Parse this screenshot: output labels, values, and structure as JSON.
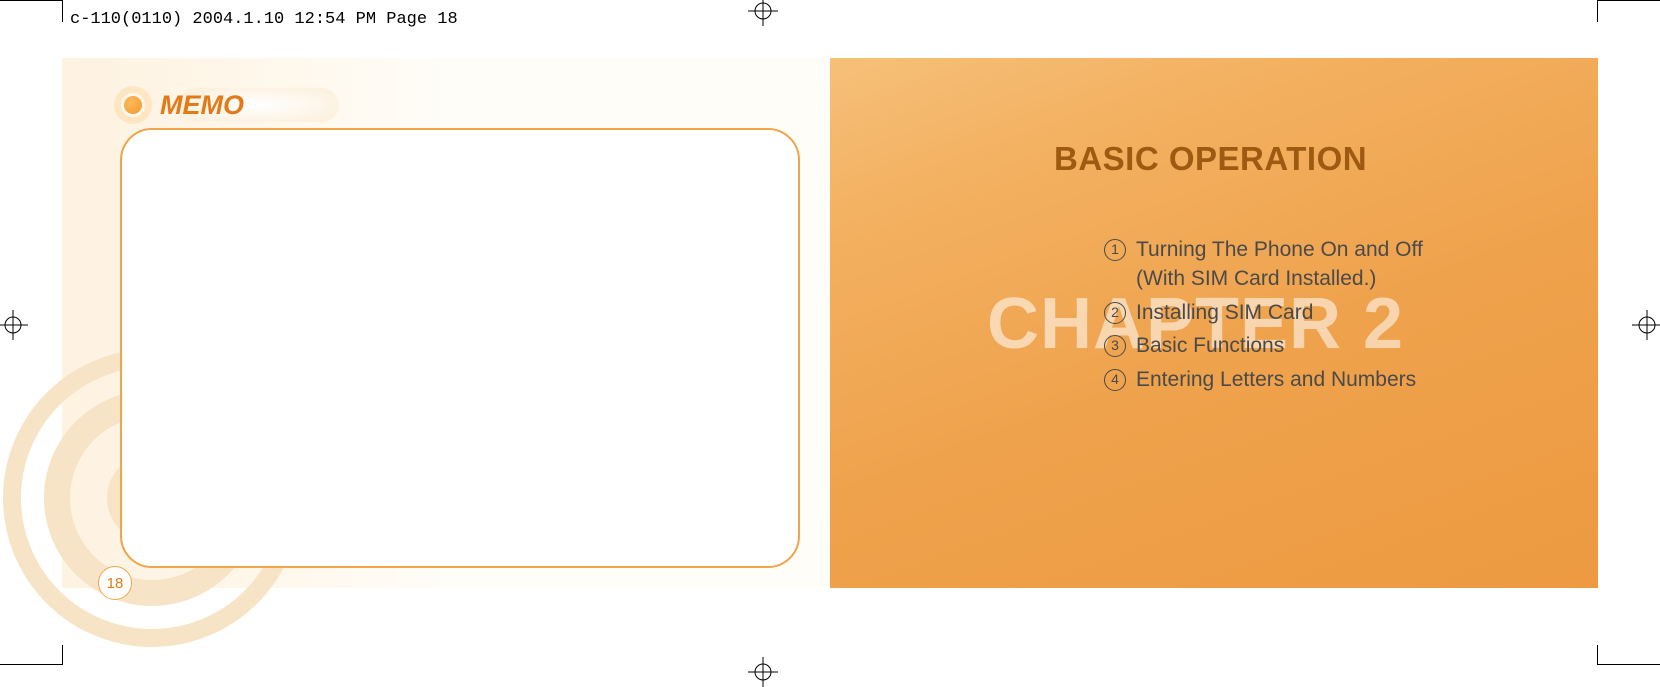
{
  "header": {
    "imposition": "c-110(0110)  2004.1.10  12:54 PM  Page 18"
  },
  "left": {
    "memo_label": "MEMO",
    "page_number": "18"
  },
  "right": {
    "title": "BASIC OPERATION",
    "watermark": "CHAPTER 2",
    "items": [
      {
        "num": "1",
        "text": "Turning The Phone On and Off\n(With SIM Card Installed.)"
      },
      {
        "num": "2",
        "text": "Installing SIM Card"
      },
      {
        "num": "3",
        "text": "Basic Functions"
      },
      {
        "num": "4",
        "text": "Entering Letters and Numbers"
      }
    ]
  }
}
